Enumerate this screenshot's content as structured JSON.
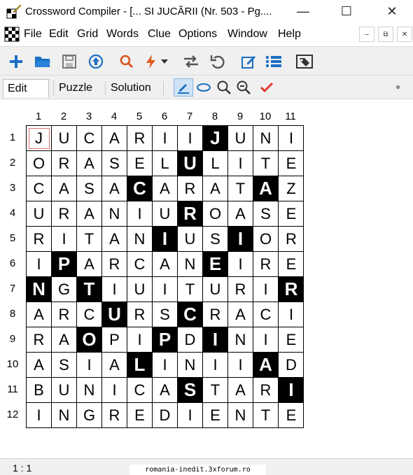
{
  "window": {
    "title": "Crossword Compiler - [... SI JUCĂRII (Nr. 503 - Pg....",
    "minimize_glyph": "—",
    "maximize_glyph": "☐",
    "close_glyph": "✕"
  },
  "menu": {
    "items": [
      "File",
      "Edit",
      "Grid",
      "Words",
      "Clue",
      "Options",
      "Window",
      "Help"
    ],
    "mdi_minimize": "–",
    "mdi_restore": "⧉",
    "mdi_close": "✕"
  },
  "toolbar": {
    "icons": [
      "add-icon",
      "open-folder-icon",
      "save-icon",
      "upload-icon",
      "search-icon",
      "lightning-icon",
      "dropdown-arrow-icon",
      "swap-icon",
      "undo-icon",
      "edit-icon",
      "list-icon",
      "tag-icon"
    ],
    "accent_color": "#1a6fc4"
  },
  "modes": {
    "edit": "Edit",
    "puzzle": "Puzzle",
    "solution": "Solution",
    "indicator": "●"
  },
  "grid": {
    "col_numbers": [
      "1",
      "2",
      "3",
      "4",
      "5",
      "6",
      "7",
      "8",
      "9",
      "10",
      "11"
    ],
    "row_numbers": [
      "1",
      "2",
      "3",
      "4",
      "5",
      "6",
      "7",
      "8",
      "9",
      "10",
      "11",
      "12"
    ],
    "rows": [
      [
        "J",
        "U",
        "C",
        "A",
        "R",
        "I",
        "I",
        "J",
        "U",
        "N",
        "I"
      ],
      [
        "O",
        "R",
        "A",
        "S",
        "E",
        "L",
        "U",
        "L",
        "I",
        "T",
        "E"
      ],
      [
        "C",
        "A",
        "S",
        "A",
        "C",
        "A",
        "R",
        "A",
        "T",
        "A",
        "Z"
      ],
      [
        "U",
        "R",
        "A",
        "N",
        "I",
        "U",
        "R",
        "O",
        "A",
        "S",
        "E"
      ],
      [
        "R",
        "I",
        "T",
        "A",
        "N",
        "I",
        "U",
        "S",
        "I",
        "O",
        "R"
      ],
      [
        "I",
        "P",
        "A",
        "R",
        "C",
        "A",
        "N",
        "E",
        "I",
        "R",
        "E"
      ],
      [
        "N",
        "G",
        "T",
        "I",
        "U",
        "I",
        "T",
        "U",
        "R",
        "I",
        "R"
      ],
      [
        "A",
        "R",
        "C",
        "U",
        "R",
        "S",
        "C",
        "R",
        "A",
        "C",
        "I"
      ],
      [
        "R",
        "A",
        "O",
        "P",
        "I",
        "P",
        "D",
        "I",
        "N",
        "I",
        "E"
      ],
      [
        "A",
        "S",
        "I",
        "A",
        "L",
        "I",
        "N",
        "I",
        "I",
        "A",
        "D"
      ],
      [
        "B",
        "U",
        "N",
        "I",
        "C",
        "A",
        "S",
        "T",
        "A",
        "R",
        "I"
      ],
      [
        "I",
        "N",
        "G",
        "R",
        "E",
        "D",
        "I",
        "E",
        "N",
        "T",
        "E"
      ]
    ],
    "black": [
      [
        0,
        7
      ],
      [
        1,
        6
      ],
      [
        2,
        4
      ],
      [
        2,
        9
      ],
      [
        3,
        6
      ],
      [
        4,
        5
      ],
      [
        4,
        8
      ],
      [
        5,
        1
      ],
      [
        5,
        7
      ],
      [
        6,
        0
      ],
      [
        6,
        2
      ],
      [
        6,
        10
      ],
      [
        7,
        3
      ],
      [
        7,
        6
      ],
      [
        8,
        2
      ],
      [
        8,
        5
      ],
      [
        8,
        7
      ],
      [
        9,
        4
      ],
      [
        9,
        9
      ],
      [
        10,
        6
      ],
      [
        10,
        10
      ]
    ],
    "cursor": [
      0,
      0
    ]
  },
  "status": {
    "position": "1 : 1"
  },
  "watermark": "romania-inedit.3xforum.ro"
}
